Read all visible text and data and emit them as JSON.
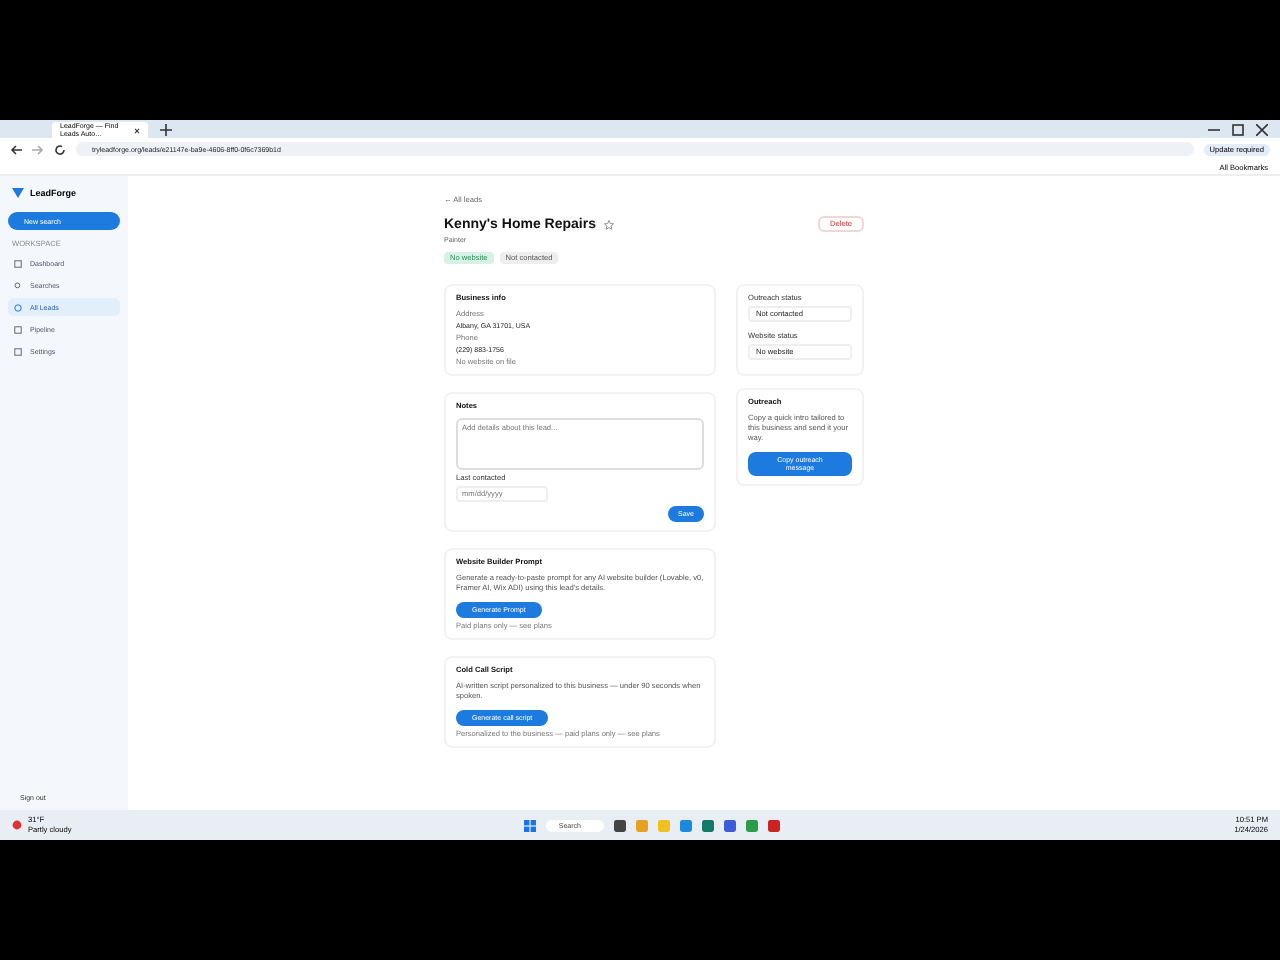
{
  "browser": {
    "tab_title": "LeadForge — Find Leads Auto…",
    "url": "tryleadforge.org/leads/e21147e-ba9e-4606-8ff0-0f6c7369b1d",
    "update_badge": "Update required",
    "bookmarks": "All Bookmarks"
  },
  "sidebar": {
    "brand": "LeadForge",
    "new_search": "New search",
    "section": "WORKSPACE",
    "items": [
      {
        "label": "Dashboard",
        "selected": false
      },
      {
        "label": "Searches",
        "selected": false
      },
      {
        "label": "All Leads",
        "selected": true
      },
      {
        "label": "Pipeline",
        "selected": false
      },
      {
        "label": "Settings",
        "selected": false
      }
    ],
    "sign_out": "Sign out"
  },
  "lead": {
    "back": "← All leads",
    "name": "Kenny's Home Repairs",
    "category": "Painter",
    "delete": "Delete",
    "tags": [
      "No website",
      "Not contacted"
    ],
    "business_info": {
      "title": "Business info",
      "address_label": "Address",
      "address": "Albany, GA 31701, USA",
      "phone_label": "Phone",
      "phone": "(229) 883-1756",
      "website": "No website on file"
    },
    "notes": {
      "title": "Notes",
      "placeholder": "Add details about this lead...",
      "last_contacted_label": "Last contacted",
      "date_placeholder": "mm/dd/yyyy",
      "save": "Save"
    },
    "prompt_card": {
      "title": "Website Builder Prompt",
      "text": "Generate a ready-to-paste prompt for any AI website builder (Lovable, v0, Framer AI, Wix ADI) using this lead's details.",
      "button": "Generate Prompt",
      "note": "Paid plans only — see plans"
    },
    "script_card": {
      "title": "Cold Call Script",
      "text": "AI-written script personalized to this business — under 90 seconds when spoken.",
      "button": "Generate call script",
      "note": "Personalized to the business — paid plans only — see plans"
    },
    "outreach_status": {
      "label": "Outreach status",
      "value": "Not contacted"
    },
    "website_status": {
      "label": "Website status",
      "value": "No website"
    },
    "outreach": {
      "title": "Outreach",
      "text": "Copy a quick intro tailored to this business and send it your way.",
      "button": "Copy outreach message"
    }
  },
  "taskbar": {
    "weather_temp": "31°F",
    "weather_text": "Partly cloudy",
    "search": "Search",
    "time": "10:51 PM",
    "date": "1/24/2026"
  }
}
